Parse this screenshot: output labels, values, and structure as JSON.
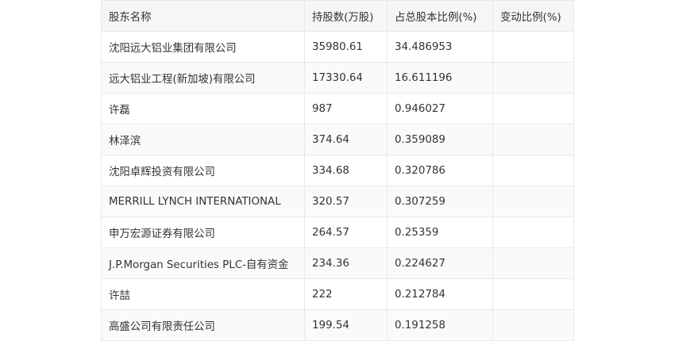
{
  "table": {
    "headers": [
      "股东名称",
      "持股数(万股)",
      "占总股本比例(%)",
      "变动比例(%)"
    ],
    "rows": [
      [
        "沈阳远大铝业集团有限公司",
        "35980.61",
        "34.486953",
        ""
      ],
      [
        "远大铝业工程(新加坡)有限公司",
        "17330.64",
        "16.611196",
        ""
      ],
      [
        "许磊",
        "987",
        "0.946027",
        ""
      ],
      [
        "林泽滨",
        "374.64",
        "0.359089",
        ""
      ],
      [
        "沈阳卓辉投资有限公司",
        "334.68",
        "0.320786",
        ""
      ],
      [
        "MERRILL LYNCH INTERNATIONAL",
        "320.57",
        "0.307259",
        ""
      ],
      [
        "申万宏源证券有限公司",
        "264.57",
        "0.25359",
        ""
      ],
      [
        "J.P.Morgan Securities PLC-自有资金",
        "234.36",
        "0.224627",
        ""
      ],
      [
        "许喆",
        "222",
        "0.212784",
        ""
      ],
      [
        "高盛公司有限责任公司",
        "199.54",
        "0.191258",
        ""
      ]
    ]
  }
}
